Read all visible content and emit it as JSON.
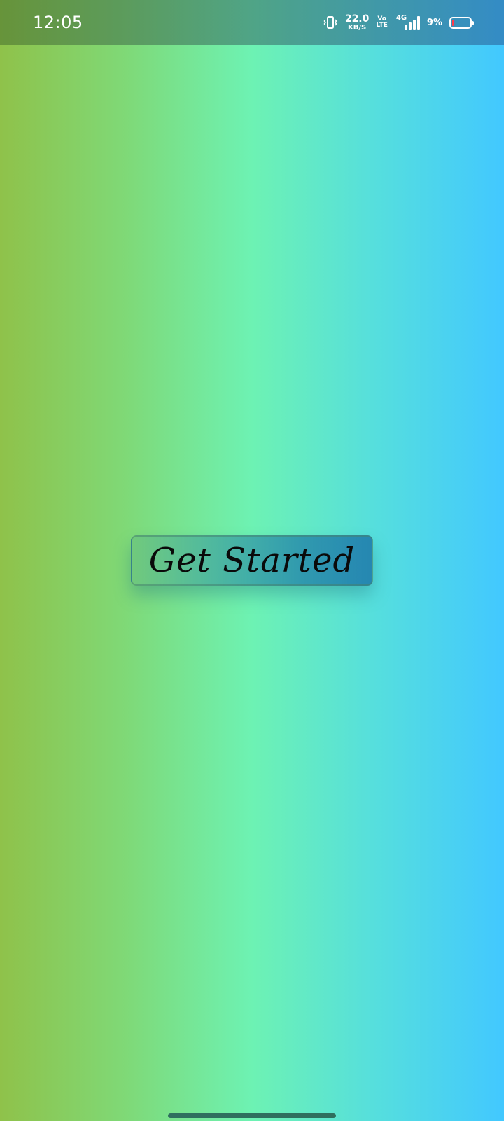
{
  "status_bar": {
    "time": "12:05",
    "net_speed_value": "22.0",
    "net_speed_unit": "KB/S",
    "volte_top": "Vo",
    "volte_bottom": "LTE",
    "network_type": "4G",
    "battery_percent": "9%",
    "battery_level": 0.09,
    "battery_low_color": "#ff3b4a",
    "icons": [
      "vibrate-icon",
      "signal-icon",
      "battery-icon"
    ]
  },
  "main": {
    "get_started_label": "Get Started"
  },
  "colors": {
    "gradient": [
      "#8fc24a",
      "#6df2b3",
      "#42c8ff"
    ]
  }
}
